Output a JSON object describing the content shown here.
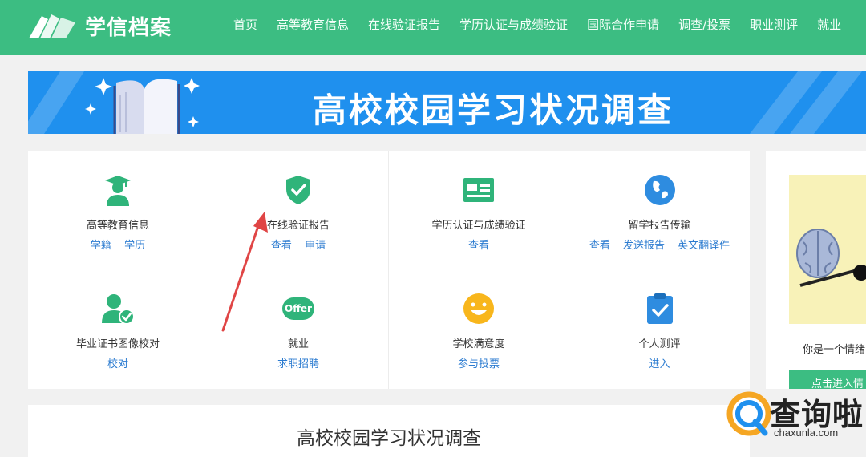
{
  "brand": {
    "name": "学信档案"
  },
  "nav": {
    "items": [
      {
        "label": "首页"
      },
      {
        "label": "高等教育信息"
      },
      {
        "label": "在线验证报告"
      },
      {
        "label": "学历认证与成绩验证"
      },
      {
        "label": "国际合作申请"
      },
      {
        "label": "调查/投票"
      },
      {
        "label": "职业测评"
      },
      {
        "label": "就业"
      }
    ]
  },
  "banner": {
    "title": "高校校园学习状况调查"
  },
  "services": [
    {
      "title": "高等教育信息",
      "icon": "graduate-icon",
      "links": [
        "学籍",
        "学历"
      ]
    },
    {
      "title": "在线验证报告",
      "icon": "shield-check-icon",
      "links": [
        "查看",
        "申请"
      ]
    },
    {
      "title": "学历认证与成绩验证",
      "icon": "certificate-card-icon",
      "links": [
        "查看"
      ]
    },
    {
      "title": "留学报告传输",
      "icon": "globe-icon",
      "links": [
        "查看",
        "发送报告",
        "英文翻译件"
      ]
    },
    {
      "title": "毕业证书图像校对",
      "icon": "user-check-icon",
      "links": [
        "校对"
      ]
    },
    {
      "title": "就业",
      "icon": "offer-icon",
      "links": [
        "求职招聘"
      ]
    },
    {
      "title": "学校满意度",
      "icon": "smiley-icon",
      "links": [
        "参与投票"
      ]
    },
    {
      "title": "个人测评",
      "icon": "clipboard-check-icon",
      "links": [
        "进入"
      ]
    }
  ],
  "side_panel": {
    "caption": "你是一个情绪",
    "button": "点击进入情"
  },
  "section": {
    "title": "高校校园学习状况调查"
  },
  "watermark": {
    "text": "查询啦",
    "domain": "chaxunla.com"
  },
  "colors": {
    "brand_green": "#3cbd82",
    "banner_blue": "#1f90ee",
    "link_blue": "#2b7bd0",
    "arrow_red": "#e04545"
  }
}
